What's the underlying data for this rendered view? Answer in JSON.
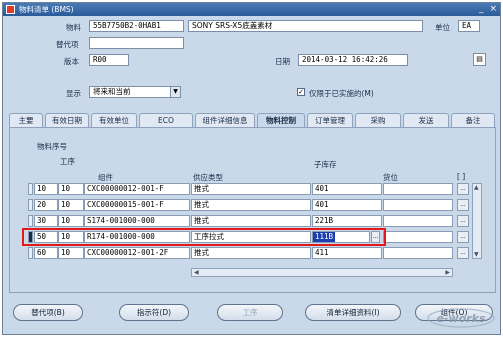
{
  "window": {
    "title": "物料清单 (BMS)",
    "controls": [
      "_",
      "×"
    ]
  },
  "header": {
    "item_label": "物料",
    "item_value": "55B7750B2-0HAB1",
    "description": "SONY SRS-X5底盖素材",
    "uom_label": "单位",
    "uom_value": "EA",
    "alternate_label": "替代项",
    "alternate_value": "",
    "revision_label": "版本",
    "revision_value": "R00",
    "date_label": "日期",
    "date_value": "2014-03-12 16:42:26",
    "display_label": "显示",
    "display_value": "将来和当前",
    "implemented_only_label": "仅限于已实施的(M)",
    "implemented_only_checked": true
  },
  "tabs": [
    {
      "label": "主要"
    },
    {
      "label": "有效日期"
    },
    {
      "label": "有效单位"
    },
    {
      "label": "ECO"
    },
    {
      "label": "组件详细信息"
    },
    {
      "label": "物料控制",
      "active": true
    },
    {
      "label": "订单管理"
    },
    {
      "label": "采购"
    },
    {
      "label": "发送"
    },
    {
      "label": "备注"
    }
  ],
  "grid": {
    "group_label": "物料序号",
    "op_seq_header": "工序",
    "component_header": "组件",
    "supply_type_header": "供应类型",
    "subinventory_header": "子库存",
    "locator_header": "货位",
    "extra_header": "[ ]",
    "rows": [
      {
        "item_seq": "10",
        "op_seq": "10",
        "component": "CXC00000012-001-F",
        "supply_type": "推式",
        "subinventory": "401",
        "locator": "",
        "current": false
      },
      {
        "item_seq": "20",
        "op_seq": "10",
        "component": "CXC00000015-001-F",
        "supply_type": "推式",
        "subinventory": "401",
        "locator": "",
        "current": false
      },
      {
        "item_seq": "30",
        "op_seq": "10",
        "component": "S174-001000-000",
        "supply_type": "推式",
        "subinventory": "221B",
        "locator": "",
        "current": false
      },
      {
        "item_seq": "50",
        "op_seq": "10",
        "component": "R174-001000-000",
        "supply_type": "工序拉式",
        "subinventory": "111B",
        "locator": "",
        "current": true
      },
      {
        "item_seq": "60",
        "op_seq": "10",
        "component": "CXC00000012-001-2F",
        "supply_type": "推式",
        "subinventory": "411",
        "locator": "",
        "current": false
      }
    ],
    "lov_glyph": "...",
    "dots_glyph": "..",
    "highlight_color": "#e21a1a",
    "selection_color": "#1b3fae"
  },
  "footer": {
    "alternates_button": "替代项(B)",
    "designator_button": "指示符(D)",
    "routing_button": "工序",
    "bom_details_button": "清单详细资料(I)",
    "last_button": "组件(O)",
    "watermark": "e-works"
  }
}
